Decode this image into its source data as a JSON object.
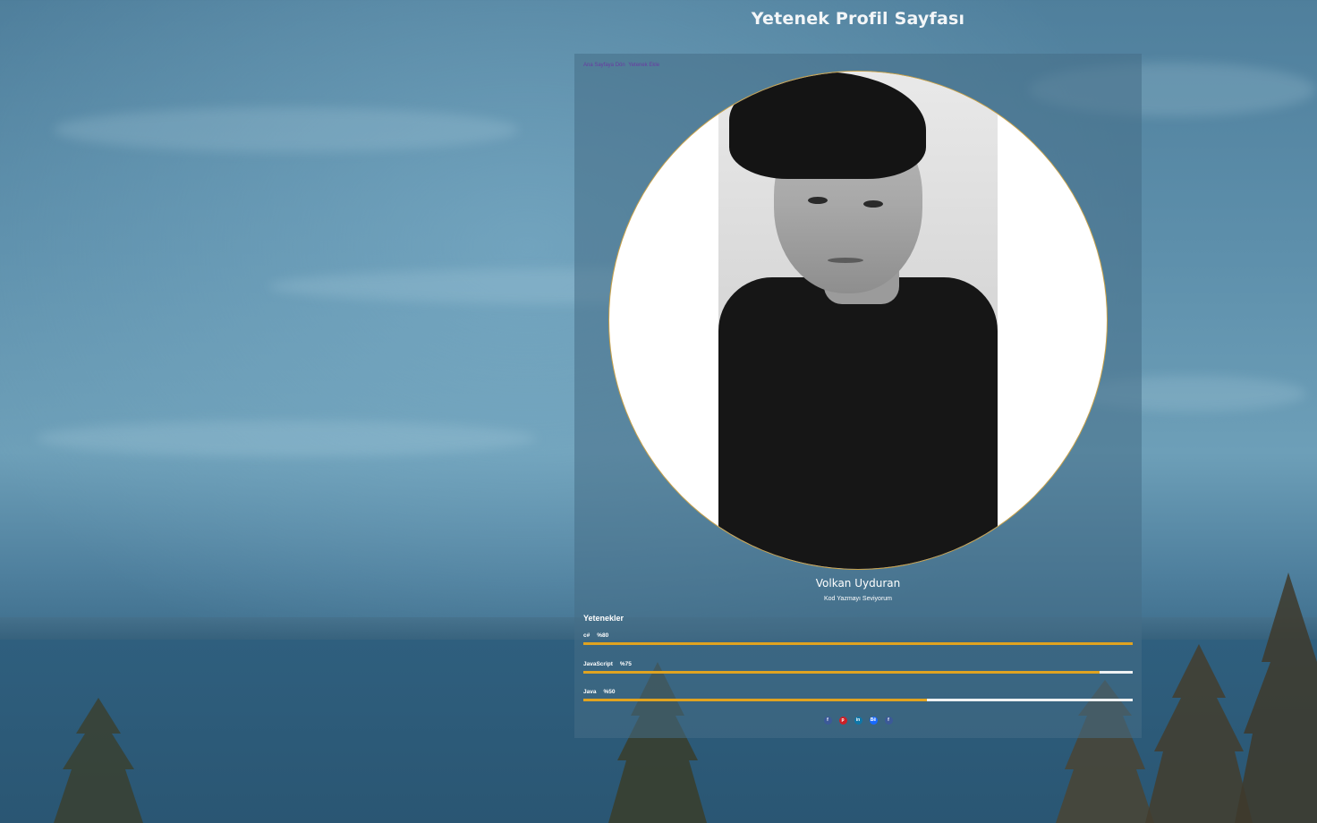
{
  "page": {
    "title": "Yetenek Profil Sayfası"
  },
  "breadcrumb": {
    "items": [
      "Ana Sayfaya Dön",
      "Yetenek Ekle"
    ]
  },
  "profile": {
    "name": "Volkan Uyduran",
    "tagline": "Kod Yazmayı Seviyorum"
  },
  "skills": {
    "heading": "Yetenekler",
    "items": [
      {
        "name": "c#",
        "percent_label": "%80",
        "level": 100
      },
      {
        "name": "JavaScript",
        "percent_label": "%75",
        "level": 94
      },
      {
        "name": "Java",
        "percent_label": "%50",
        "level": 62.5
      }
    ]
  },
  "social": [
    {
      "icon": "facebook-icon",
      "glyph": "f",
      "color": "#3b5998"
    },
    {
      "icon": "pinterest-icon",
      "glyph": "p",
      "color": "#cb2027"
    },
    {
      "icon": "linkedin-icon",
      "glyph": "in",
      "color": "#0e76a8"
    },
    {
      "icon": "behance-icon",
      "glyph": "Bē",
      "color": "#1769ff"
    },
    {
      "icon": "facebook-icon",
      "glyph": "f",
      "color": "#3b5998"
    }
  ],
  "colors": {
    "accent": "#e0a320",
    "avatar_border": "#c9a24a",
    "breadcrumb": "#6a3aa2"
  }
}
